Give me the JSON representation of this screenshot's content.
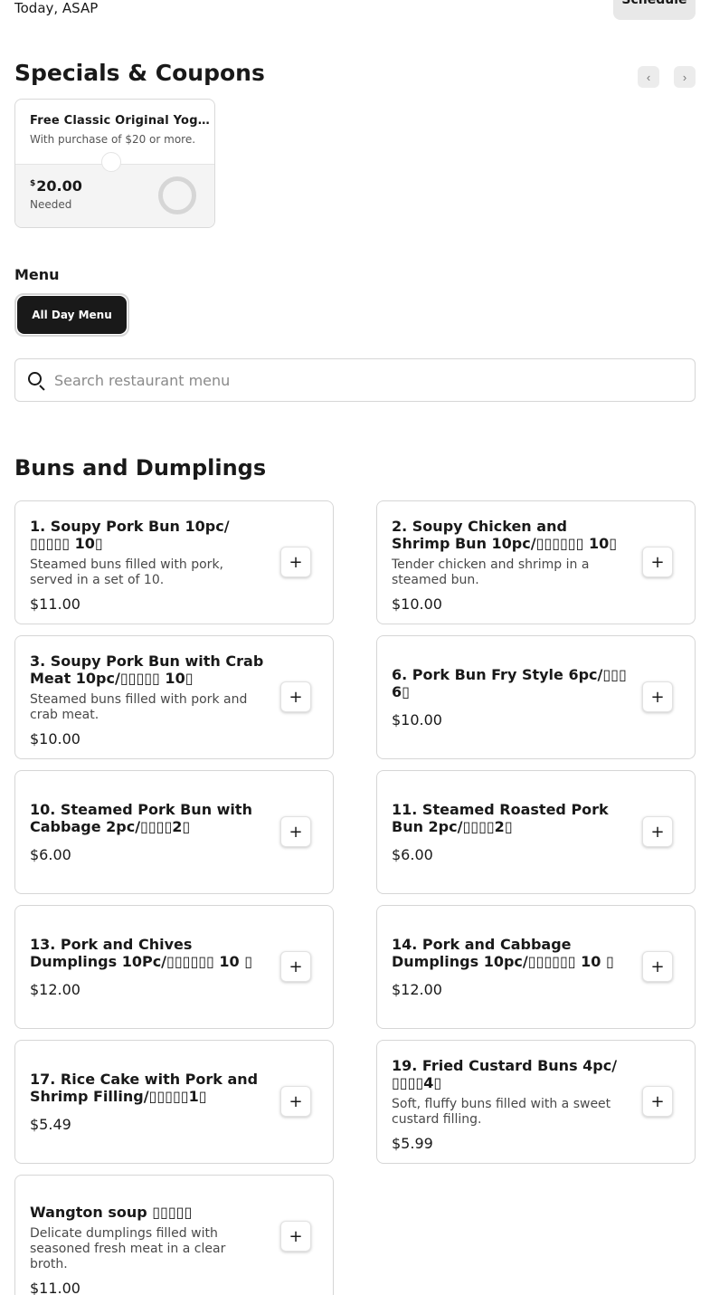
{
  "header": {
    "delivery_time": "Today, ASAP",
    "schedule_label": "Schedule"
  },
  "specials": {
    "title": "Specials & Coupons",
    "prev_icon": "‹",
    "next_icon": "›",
    "coupon": {
      "title": "Free Classic Original Yogurt …",
      "subtitle": "With purchase of $20 or more.",
      "currency": "$",
      "amount": "20.00",
      "needed_label": "Needed",
      "progress": 0
    }
  },
  "menu": {
    "label": "Menu",
    "active_menu": "All Day Menu"
  },
  "search": {
    "placeholder": "Search restaurant menu",
    "icon": "search-icon"
  },
  "section": {
    "title": "Buns and Dumplings",
    "add_icon": "+",
    "items": [
      {
        "name": "1. Soupy Pork Bun 10pc/▯▯▯▯▯ 10▯",
        "description": "Steamed buns filled with pork, served in a set of 10.",
        "price": "$11.00"
      },
      {
        "name": "2. Soupy Chicken and Shrimp Bun 10pc/▯▯▯▯▯▯ 10▯",
        "description": "Tender chicken and shrimp in a steamed bun.",
        "price": "$10.00"
      },
      {
        "name": "3. Soupy Pork Bun with Crab Meat 10pc/▯▯▯▯▯ 10▯",
        "description": "Steamed buns filled with pork and crab meat.",
        "price": "$10.00"
      },
      {
        "name": "6. Pork Bun Fry Style 6pc/▯▯▯ 6▯",
        "description": "",
        "price": "$10.00"
      },
      {
        "name": "10. Steamed Pork Bun with Cabbage 2pc/▯▯▯▯2▯",
        "description": "",
        "price": "$6.00"
      },
      {
        "name": "11. Steamed Roasted Pork Bun 2pc/▯▯▯▯2▯",
        "description": "",
        "price": "$6.00"
      },
      {
        "name": "13. Pork and Chives Dumplings 10Pc/▯▯▯▯▯▯ 10 ▯",
        "description": "",
        "price": "$12.00"
      },
      {
        "name": "14. Pork and Cabbage Dumplings 10pc/▯▯▯▯▯▯ 10 ▯",
        "description": "",
        "price": "$12.00"
      },
      {
        "name": "17. Rice Cake with Pork and Shrimp Filling/▯▯▯▯▯1▯",
        "description": "",
        "price": "$5.49"
      },
      {
        "name": "19. Fried Custard Buns 4pc/▯▯▯▯4▯",
        "description": "Soft, fluffy buns filled with a sweet custard filling.",
        "price": "$5.99"
      },
      {
        "name": "Wangton soup ▯▯▯▯▯",
        "description": "Delicate dumplings filled with seasoned fresh meat in a clear broth.",
        "price": "$11.00"
      }
    ]
  }
}
